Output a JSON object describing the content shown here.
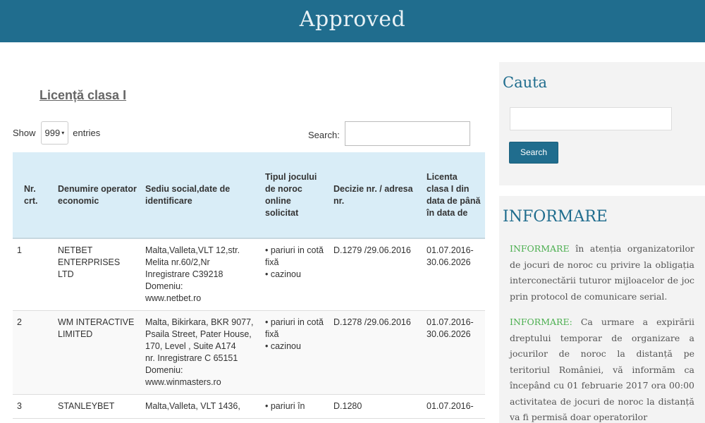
{
  "header": {
    "title": "Approved"
  },
  "main": {
    "section_title": "Licență clasa I",
    "show_label": "Show",
    "entries_select": "999",
    "entries_label": "entries",
    "search_label": "Search:",
    "table": {
      "headers": [
        "Nr. crt.",
        "Denumire operator economic",
        "Sediu social,date de identificare",
        "Tipul jocului de noroc online solicitat",
        "Decizie nr. / adresa nr.",
        "Licenta clasa I din data de până în data de"
      ],
      "rows": [
        {
          "nr": "1",
          "operator": "NETBET ENTERPRISES LTD",
          "sediu": [
            "Malta,Valleta,VLT 12,str. Melita nr.60/2,Nr Inregistrare C39218",
            "Domeniu:",
            "www.netbet.ro"
          ],
          "tip": [
            "pariuri in cotă fixă",
            "cazinou"
          ],
          "decizie": "D.1279 /29.06.2016",
          "licenta": "01.07.2016-30.06.2026"
        },
        {
          "nr": "2",
          "operator": "WM INTERACTIVE LIMITED",
          "sediu": [
            "Malta, Bikirkara, BKR 9077, Psaila Street, Pater House, 170, Level , Suite A174",
            "nr. Inregistrare C 65151",
            "Domeniu:",
            "www.winmasters.ro"
          ],
          "tip": [
            "pariuri in cotă fixă",
            "cazinou"
          ],
          "decizie": "D.1278 /29.06.2016",
          "licenta": "01.07.2016-30.06.2026"
        },
        {
          "nr": "3",
          "operator": "STANLEYBET",
          "sediu": [
            "Malta,Valleta, VLT 1436,"
          ],
          "tip": [
            "pariuri în"
          ],
          "decizie": "D.1280",
          "licenta": "01.07.2016-"
        }
      ]
    }
  },
  "sidebar": {
    "cauta_title": "Cauta",
    "cauta_button": "Search",
    "info_title": "INFORMARE",
    "info_items": [
      {
        "lead": "INFORMARE",
        "text": " în atenția organizatorilor de jocuri de noroc cu privire la obligația interconectării tuturor mijloacelor de joc prin protocol de comunicare serial."
      },
      {
        "lead": "INFORMARE:",
        "text": " Ca urmare a expirării dreptului temporar de organizare a jocurilor de noroc la distanță pe teritoriul României, vă informăm ca începând cu 01 februarie 2017 ora 00:00 activitatea de jocuri de noroc la distanță va fi permisă doar operatorilor"
      }
    ]
  },
  "colors": {
    "header_bg": "#206d8e",
    "table_header_bg": "#d9edf7",
    "accent_green": "#4caf50",
    "button_bg": "#206d8e"
  }
}
